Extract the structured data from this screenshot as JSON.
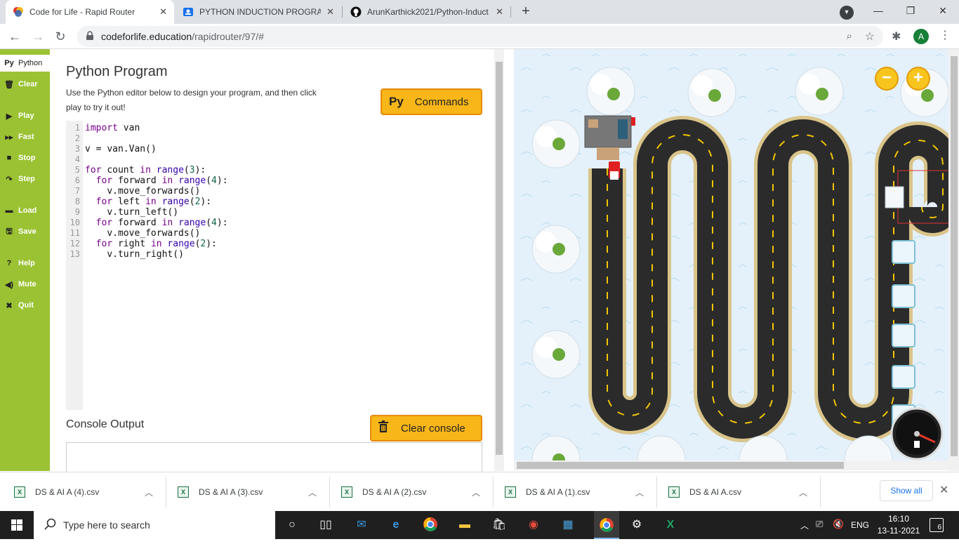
{
  "browser": {
    "tabs": [
      {
        "title": "Code for Life - Rapid Router",
        "active": true
      },
      {
        "title": "PYTHON INDUCTION PROGRAM",
        "active": false
      },
      {
        "title": "ArunKarthick2021/Python-Induct",
        "active": false
      }
    ],
    "new_tab": "+",
    "window_controls": {
      "minimize": "—",
      "maximize": "❐",
      "close": "✕"
    },
    "url_host": "codeforlife.education",
    "url_path": "/rapidrouter/97/#",
    "profile_initial": "A"
  },
  "sidebar": {
    "items": [
      {
        "icon": "Py",
        "label": "Python"
      },
      {
        "icon": "🗑",
        "label": "Clear"
      },
      {
        "icon": "▶",
        "label": "Play"
      },
      {
        "icon": "▸▸",
        "label": "Fast"
      },
      {
        "icon": "■",
        "label": "Stop"
      },
      {
        "icon": "↷",
        "label": "Step"
      },
      {
        "icon": "▬",
        "label": "Load"
      },
      {
        "icon": "🖫",
        "label": "Save"
      },
      {
        "icon": "?",
        "label": "Help"
      },
      {
        "icon": "◀)",
        "label": "Mute"
      },
      {
        "icon": "✖",
        "label": "Quit"
      }
    ]
  },
  "editor_panel": {
    "title": "Python Program",
    "description": "Use the Python editor below to design your program, and then click play to try it out!",
    "commands_button": {
      "prefix": "Py",
      "label": "Commands"
    },
    "line_numbers": [
      "1",
      "2",
      "3",
      "4",
      "5",
      "6",
      "7",
      "8",
      "9",
      "10",
      "11",
      "12",
      "13"
    ],
    "code_lines": [
      "import van",
      "",
      "v = van.Van()",
      "",
      "for count in range(3):",
      "  for forward in range(4):",
      "    v.move_forwards()",
      "  for left in range(2):",
      "    v.turn_left()",
      "  for forward in range(4):",
      "    v.move_forwards()",
      "  for right in range(2):",
      "    v.turn_right()"
    ],
    "console_title": "Console Output",
    "clear_console_label": "Clear console"
  },
  "game": {
    "zoom_out": "−",
    "zoom_in": "+"
  },
  "downloads": {
    "files": [
      "DS & AI A (4).csv",
      "DS & AI A (3).csv",
      "DS & AI A (2).csv",
      "DS & AI A (1).csv",
      "DS & AI A.csv"
    ],
    "show_all": "Show all"
  },
  "taskbar": {
    "search_placeholder": "Type here to search",
    "language": "ENG",
    "time": "16:10",
    "date": "13-11-2021",
    "notification_count": "6"
  },
  "colors": {
    "sidebar_green": "#9bc233",
    "button_yellow": "#f8b619",
    "button_border": "#e68a0a",
    "road": "#2b2b2b",
    "road_edge": "#d9c48a",
    "snow_bg": "#e4f1fb"
  }
}
